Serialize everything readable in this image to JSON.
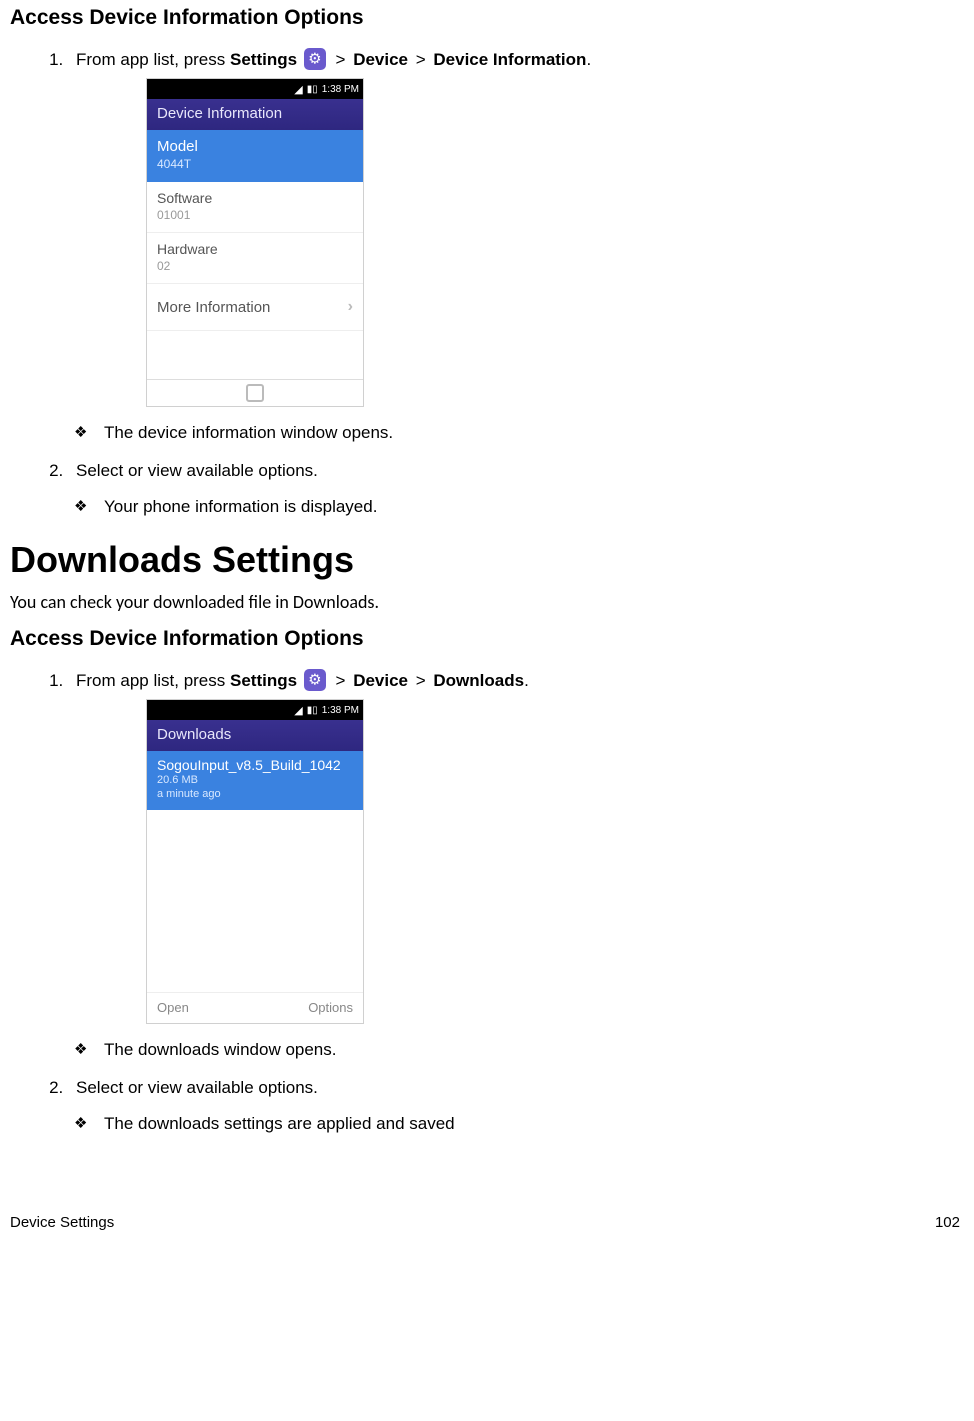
{
  "section1": {
    "heading": "Access Device Information Options",
    "step1_prefix": "From app list, press ",
    "step1_bold1": "Settings",
    "step1_mid": " > ",
    "step1_bold2": "Device",
    "step1_mid2": " > ",
    "step1_bold3": "Device Information",
    "step1_suffix": ".",
    "note1": "The device information window opens.",
    "step2": "Select or view available options.",
    "note2": "Your phone information is displayed."
  },
  "phone1": {
    "time": "1:38 PM",
    "header": "Device Information",
    "model_label": "Model",
    "model_value": "4044T",
    "software_label": "Software",
    "software_value": "01001",
    "hardware_label": "Hardware",
    "hardware_value": "02",
    "more_label": "More Information"
  },
  "section2": {
    "h1": "Downloads Settings",
    "intro": "You can check your downloaded file in Downloads.",
    "heading": "Access Device Information Options",
    "step1_prefix": "From app list, press ",
    "step1_bold1": "Settings",
    "step1_mid": " > ",
    "step1_bold2": "Device",
    "step1_mid2": " > ",
    "step1_bold3": "Downloads",
    "step1_suffix": ".",
    "note1": "The downloads window opens.",
    "step2": "Select or view available options.",
    "note2": "The downloads settings are applied and saved"
  },
  "phone2": {
    "time": "1:38 PM",
    "header": "Downloads",
    "file_name": "SogouInput_v8.5_Build_1042",
    "file_size": "20.6 MB",
    "file_age": "a minute ago",
    "softkey_left": "Open",
    "softkey_right": "Options"
  },
  "footer": {
    "left": "Device Settings",
    "right": "102"
  }
}
